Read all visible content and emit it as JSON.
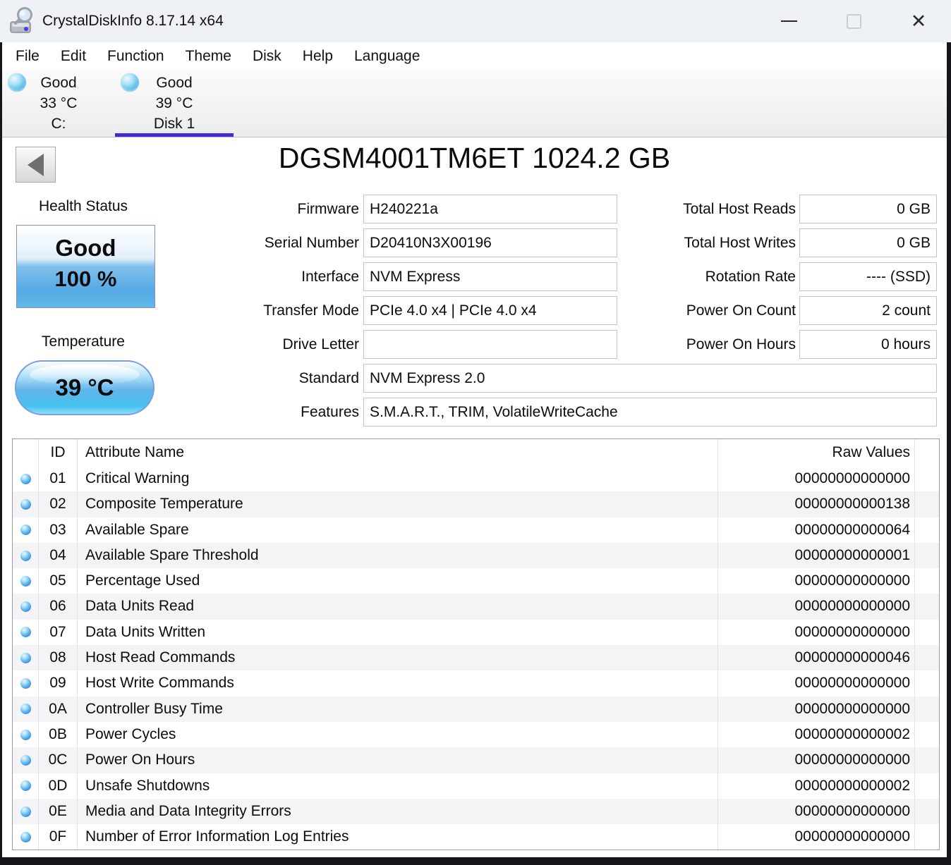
{
  "window": {
    "title": "CrystalDiskInfo 8.17.14 x64"
  },
  "menu": {
    "items": [
      "File",
      "Edit",
      "Function",
      "Theme",
      "Disk",
      "Help",
      "Language"
    ]
  },
  "disk_tabs": [
    {
      "status": "Good",
      "temperature": "33 °C",
      "name": "C:",
      "selected": false
    },
    {
      "status": "Good",
      "temperature": "39 °C",
      "name": "Disk 1",
      "selected": true
    }
  ],
  "drive": {
    "title": "DGSM4001TM6ET 1024.2 GB",
    "health_label": "Health Status",
    "health_status": "Good",
    "health_percent": "100 %",
    "temp_label": "Temperature",
    "temp_value": "39 °C",
    "mid_fields": [
      {
        "label": "Firmware",
        "value": "H240221a"
      },
      {
        "label": "Serial Number",
        "value": "D20410N3X00196"
      },
      {
        "label": "Interface",
        "value": "NVM Express"
      },
      {
        "label": "Transfer Mode",
        "value": "PCIe 4.0 x4 | PCIe 4.0 x4"
      },
      {
        "label": "Drive Letter",
        "value": ""
      },
      {
        "label": "Standard",
        "value": "NVM Express 2.0"
      },
      {
        "label": "Features",
        "value": "S.M.A.R.T., TRIM, VolatileWriteCache"
      }
    ],
    "right_fields": [
      {
        "label": "Total Host Reads",
        "value": "0 GB"
      },
      {
        "label": "Total Host Writes",
        "value": "0 GB"
      },
      {
        "label": "Rotation Rate",
        "value": "---- (SSD)"
      },
      {
        "label": "Power On Count",
        "value": "2 count"
      },
      {
        "label": "Power On Hours",
        "value": "0 hours"
      }
    ]
  },
  "smart_table": {
    "headers": {
      "id": "ID",
      "name": "Attribute Name",
      "raw": "Raw Values"
    },
    "rows": [
      {
        "id": "01",
        "name": "Critical Warning",
        "raw": "00000000000000"
      },
      {
        "id": "02",
        "name": "Composite Temperature",
        "raw": "00000000000138"
      },
      {
        "id": "03",
        "name": "Available Spare",
        "raw": "00000000000064"
      },
      {
        "id": "04",
        "name": "Available Spare Threshold",
        "raw": "00000000000001"
      },
      {
        "id": "05",
        "name": "Percentage Used",
        "raw": "00000000000000"
      },
      {
        "id": "06",
        "name": "Data Units Read",
        "raw": "00000000000000"
      },
      {
        "id": "07",
        "name": "Data Units Written",
        "raw": "00000000000000"
      },
      {
        "id": "08",
        "name": "Host Read Commands",
        "raw": "00000000000046"
      },
      {
        "id": "09",
        "name": "Host Write Commands",
        "raw": "00000000000000"
      },
      {
        "id": "0A",
        "name": "Controller Busy Time",
        "raw": "00000000000000"
      },
      {
        "id": "0B",
        "name": "Power Cycles",
        "raw": "00000000000002"
      },
      {
        "id": "0C",
        "name": "Power On Hours",
        "raw": "00000000000000"
      },
      {
        "id": "0D",
        "name": "Unsafe Shutdowns",
        "raw": "00000000000002"
      },
      {
        "id": "0E",
        "name": "Media and Data Integrity Errors",
        "raw": "00000000000000"
      },
      {
        "id": "0F",
        "name": "Number of Error Information Log Entries",
        "raw": "00000000000000"
      }
    ]
  },
  "colors": {
    "selected_tab_underline": "#3b2ed8",
    "health_gradient_blue": "#55a9e4",
    "titlebar_bg": "#eef1f6",
    "window_frame": "#15161a"
  }
}
